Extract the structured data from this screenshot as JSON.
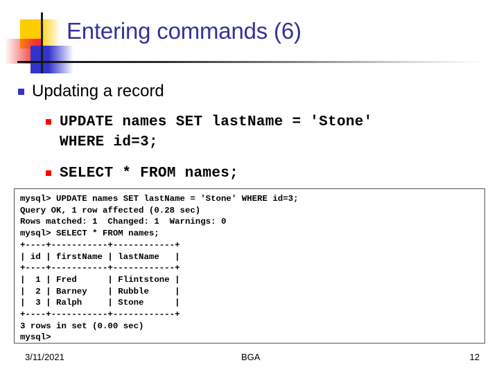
{
  "slide": {
    "title": "Entering commands (6)",
    "accent_colors": {
      "title_blue": "#333399",
      "logo_yellow": "#FFCC00",
      "logo_red": "#F23030",
      "logo_blue": "#3333CC",
      "bullet_red": "#FF0000",
      "rule_dark": "#111111"
    }
  },
  "content": {
    "heading": "Updating a record",
    "code_blocks": [
      "UPDATE names SET lastName = 'Stone'\nWHERE id=3;",
      "SELECT * FROM names;"
    ]
  },
  "terminal": {
    "lines": [
      "mysql> UPDATE names SET lastName = 'Stone' WHERE id=3;",
      "Query OK, 1 row affected (0.28 sec)",
      "Rows matched: 1  Changed: 1  Warnings: 0",
      "mysql> SELECT * FROM names;",
      "+----+-----------+------------+",
      "| id | firstName | lastName   |",
      "+----+-----------+------------+",
      "|  1 | Fred      | Flintstone |",
      "|  2 | Barney    | Rubble     |",
      "|  3 | Ralph     | Stone      |",
      "+----+-----------+------------+",
      "3 rows in set (0.00 sec)",
      "mysql>"
    ],
    "text": "mysql> UPDATE names SET lastName = 'Stone' WHERE id=3;\nQuery OK, 1 row affected (0.28 sec)\nRows matched: 1  Changed: 1  Warnings: 0\nmysql> SELECT * FROM names;\n+----+-----------+------------+\n| id | firstName | lastName   |\n+----+-----------+------------+\n|  1 | Fred      | Flintstone |\n|  2 | Barney    | Rubble     |\n|  3 | Ralph     | Stone      |\n+----+-----------+------------+\n3 rows in set (0.00 sec)\nmysql>",
    "result_table": {
      "columns": [
        "id",
        "firstName",
        "lastName"
      ],
      "rows": [
        [
          "1",
          "Fred",
          "Flintstone"
        ],
        [
          "2",
          "Barney",
          "Rubble"
        ],
        [
          "3",
          "Ralph",
          "Stone"
        ]
      ],
      "row_count_message": "3 rows in set (0.00 sec)",
      "prompt": "mysql>"
    }
  },
  "footer": {
    "date": "3/11/2021",
    "center": "BGA",
    "page_number": "12"
  }
}
